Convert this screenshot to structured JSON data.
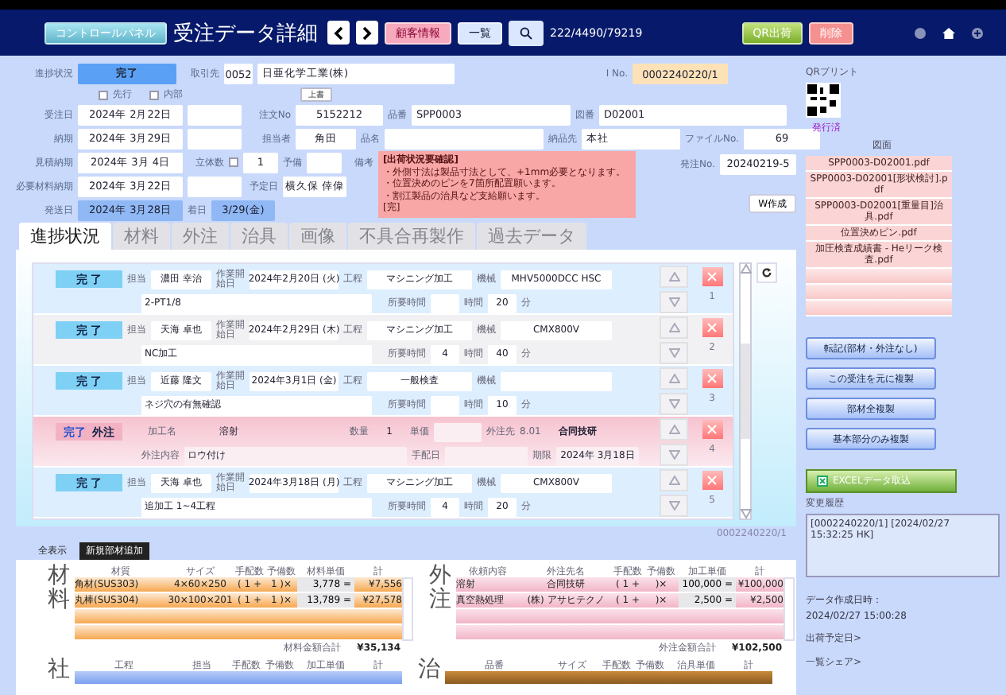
{
  "header": {
    "panel_button": "コントロールパネル",
    "title": "受注データ詳細",
    "customer_button": "顧客情報",
    "list_button": "一覧",
    "counter": "222/4490/79219",
    "ship_button": "QR出荷",
    "delete_button": "削除"
  },
  "form": {
    "status_label": "進捗状況",
    "status": "完了",
    "client_label": "取引先",
    "client_code": "0052",
    "client_name": "日亜化学工業(株)",
    "ino_label": "I No.",
    "ino": "0002240220/1",
    "checks": [
      {
        "label": "先行",
        "checked": false
      },
      {
        "label": "内部",
        "checked": false
      }
    ],
    "overwrite_button": "上書",
    "order_date_label": "受注日",
    "order_date": "2024年 2月22日",
    "order_no_label": "注文No",
    "order_no": "5152212",
    "part_no_label": "品番",
    "part_no": "SPP0003",
    "drawing_no_label": "図番",
    "drawing_no": "D02001",
    "due_label": "納期",
    "due": "2024年 3月29日",
    "staff_label": "担当者",
    "staff": "角田",
    "product_label": "品名",
    "dest_label": "納品先",
    "dest": "本社",
    "file_label": "ファイルNo.",
    "file": "69",
    "quote_due_label": "見積納期",
    "quote_due": "2024年 3月 4日",
    "qty_label": "立体数",
    "qty_checked": false,
    "qty": "1",
    "spare_label": "予備",
    "note_label": "備考",
    "note_lines": [
      "[出荷状況要確認]",
      "・外側寸法は製品寸法として、+1mm必要となります。",
      "・位置決めのピンを7箇所配置願います。",
      "・割江製品の治具など支給願います。",
      "[完]"
    ],
    "po_label": "発注No.",
    "po": "20240219-5",
    "material_due_label": "必要材料納期",
    "material_due": "2024年 3月22日",
    "plan_label": "予定日",
    "plan": "横久保 倖偉",
    "ship_label": "発送日",
    "ship": "2024年 3月28日",
    "arrival_label": "着日",
    "arrival": "3/29(金)",
    "w_button": "W作成"
  },
  "tabs": [
    {
      "label": "進捗状況",
      "selected": true
    },
    {
      "label": "材料",
      "selected": false
    },
    {
      "label": "外注",
      "selected": false
    },
    {
      "label": "治具",
      "selected": false
    },
    {
      "label": "画像",
      "selected": false
    },
    {
      "label": "不具合再製作",
      "selected": false
    },
    {
      "label": "過去データ",
      "selected": false
    }
  ],
  "processes": [
    {
      "kind": "work",
      "status": "完 了",
      "staff_label": "担当",
      "staff": "濃田 幸治",
      "date_label": "作業開始日",
      "date": "2024年2月20日 (火)",
      "process_label": "工程",
      "process": "マシニング加工",
      "machine_label": "機械",
      "machine": "MHV5000DCC HSC",
      "memo": "2-PT1/8",
      "req_label": "所要時間",
      "time_label": "時間",
      "time": "20",
      "unit": "分",
      "number": "1"
    },
    {
      "kind": "work",
      "status": "完 了",
      "staff_label": "担当",
      "staff": "天海 卓也",
      "date_label": "作業開始日",
      "date": "2024年2月29日 (木)",
      "process_label": "工程",
      "process": "マシニング加工",
      "machine_label": "機械",
      "machine": "CMX800V",
      "memo": "NC加工",
      "req_label": "所要時間",
      "req": "4",
      "time_label": "時間",
      "time": "40",
      "unit": "分",
      "number": "2"
    },
    {
      "kind": "work",
      "status": "完 了",
      "staff_label": "担当",
      "staff": "近藤 隆文",
      "date_label": "作業開始日",
      "date": "2024年3月1日 (金)",
      "process_label": "工程",
      "process": "一般検査",
      "machine_label": "機械",
      "memo": "ネジ穴の有無確認",
      "req_label": "所要時間",
      "time_label": "時間",
      "time": "10",
      "unit": "分",
      "number": "3"
    },
    {
      "kind": "outsource",
      "status": "完了",
      "type_label": "外注",
      "name_label": "加工名",
      "name": "溶射",
      "qty_label": "数量",
      "qty": "1",
      "price_label": "単価",
      "vendor_label": "外注先",
      "vendor_code": "8.01",
      "vendor": "合同技研",
      "content_label": "外注内容",
      "content": "ロウ付け",
      "arrange_label": "手配日",
      "deadline_label": "期限",
      "deadline": "2024年 3月18日",
      "number": "4"
    },
    {
      "kind": "work",
      "status": "完 了",
      "staff_label": "担当",
      "staff": "天海 卓也",
      "date_label": "作業開始日",
      "date": "2024年3月18日 (月)",
      "process_label": "工程",
      "process": "マシニング加工",
      "machine_label": "機械",
      "machine": "CMX800V",
      "memo": "追加工 1~4工程",
      "req_label": "所要時間",
      "req": "4",
      "time_label": "時間",
      "time": "20",
      "unit": "分",
      "number": "5"
    }
  ],
  "record_id": "0002240220/1",
  "bottom_tabs": [
    {
      "label": "全表示",
      "selected": true
    },
    {
      "label": "新規部材追加",
      "selected": false
    }
  ],
  "materials": {
    "title": "材料",
    "columns": [
      "材質",
      "サイズ",
      "手配数",
      "予備数",
      "材料単価",
      "計"
    ],
    "rows": [
      {
        "cells": [
          "角材(SUS303)",
          "4×60×250",
          "( 1 +",
          "1 )×",
          "3,778 =",
          "¥7,556"
        ]
      },
      {
        "cells": [
          "丸棒(SUS304)",
          "30×100×201",
          "( 1 +",
          "1 )×",
          "13,789 =",
          "¥27,578"
        ]
      }
    ],
    "total_label": "材料金額合計",
    "total": "¥35,134"
  },
  "outsource": {
    "title": "外注",
    "columns": [
      "依頼内容",
      "外注先名",
      "手配数",
      "予備数",
      "加工単価",
      "計"
    ],
    "rows": [
      {
        "cells": [
          "溶射",
          "合同技研",
          "( 1 +",
          ")×",
          "100,000 =",
          "¥100,000"
        ]
      },
      {
        "cells": [
          "真空熱処理",
          "(株) アサヒテクノ",
          "( 1 +",
          ")×",
          "2,500 =",
          "¥2,500"
        ]
      }
    ],
    "total_label": "外注金額合計",
    "total": "¥102,500"
  },
  "inhouse": {
    "title": "社",
    "columns": [
      "工程",
      "担当",
      "手配数",
      "予備数",
      "加工単価",
      "計"
    ]
  },
  "jig": {
    "title": "治",
    "columns": [
      "品番",
      "サイズ",
      "手配数",
      "予備数",
      "治具単価",
      "計"
    ]
  },
  "side": {
    "qr_label": "QRプリント",
    "qr_status": "発行済",
    "drawings_label": "図面",
    "drawings": [
      "SPP0003-D02001.pdf",
      "SPP0003-D02001[形状検討].pdf",
      "SPP0003-D02001[重量目]治具.pdf",
      "位置決めピン.pdf",
      "加圧検査成績書 - Heリーク検査.pdf"
    ],
    "actions": [
      "転記(部材・外注なし)",
      "この受注を元に複製",
      "部材全複製",
      "基本部分のみ複製"
    ],
    "excel_button": "EXCELデータ取込",
    "history_label": "変更履歴",
    "history": "[0002240220/1] [2024/02/27 15:32:25 HK]",
    "created_label": "データ作成日時：",
    "created": "2024/02/27 15:00:28",
    "ship_link": "出荷予定日>",
    "share_link": "一覧シェア>"
  }
}
